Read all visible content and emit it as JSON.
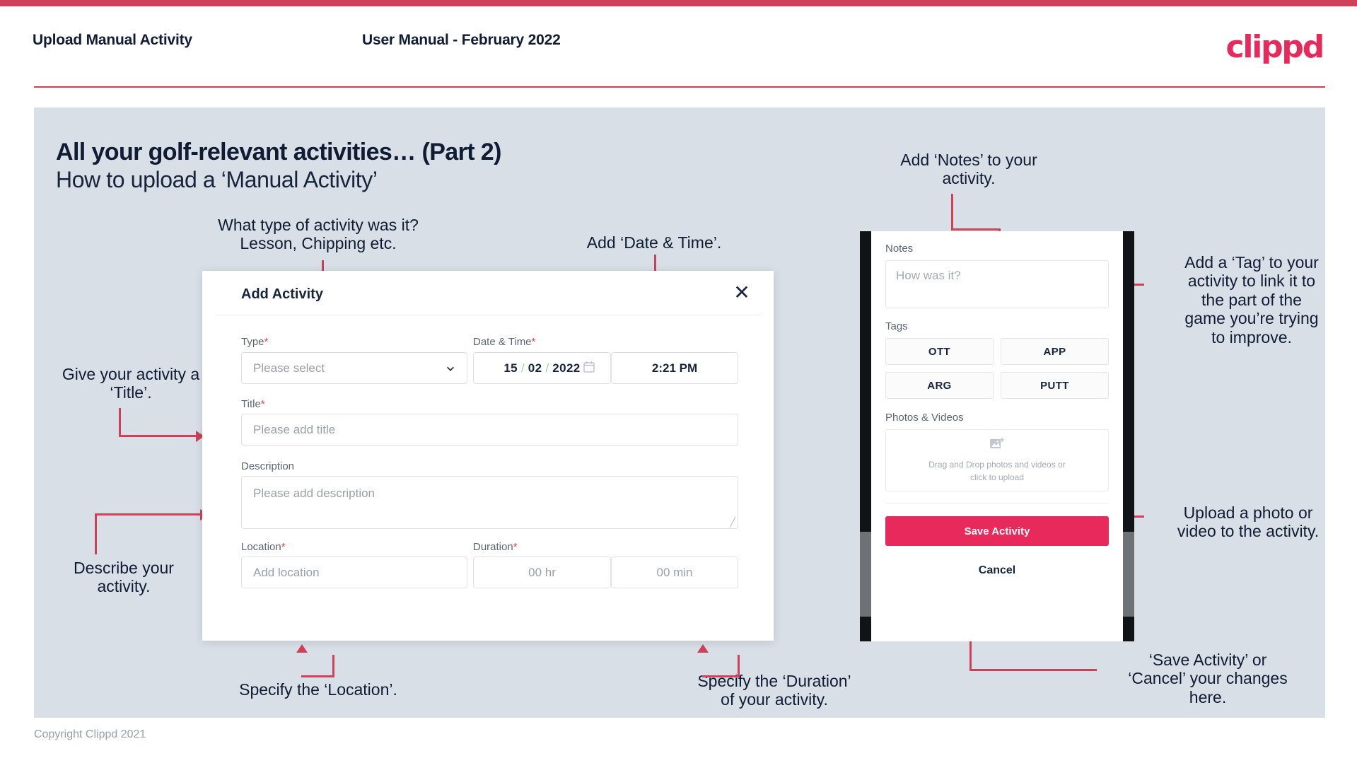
{
  "header": {
    "title": "Upload Manual Activity",
    "subtitle": "User Manual - February 2022",
    "logo": "clippd"
  },
  "slide": {
    "title": "All your golf-relevant activities… (Part 2)",
    "subtitle": "How to upload a ‘Manual Activity’"
  },
  "annotations": {
    "type": "What type of activity was it?\nLesson, Chipping etc.",
    "datetime": "Add ‘Date & Time’.",
    "title_field": "Give your activity a\n‘Title’.",
    "description": "Describe your\nactivity.",
    "location": "Specify the ‘Location’.",
    "duration": "Specify the ‘Duration’\nof your activity.",
    "notes": "Add ‘Notes’ to your\nactivity.",
    "tags": "Add a ‘Tag’ to your\nactivity to link it to\nthe part of the\ngame you’re trying\nto improve.",
    "photos": "Upload a photo or\nvideo to the activity.",
    "save_cancel": "‘Save Activity’ or\n‘Cancel’ your changes\nhere."
  },
  "modal": {
    "title": "Add Activity",
    "close_icon": "close-icon",
    "fields": {
      "type": {
        "label": "Type",
        "required": "*",
        "placeholder": "Please select",
        "chevron_icon": "chevron-down-icon"
      },
      "datetime": {
        "label": "Date & Time",
        "required": "*",
        "day": "15",
        "month": "02",
        "year": "2022",
        "sep": "/",
        "calendar_icon": "calendar-icon",
        "time": "2:21 PM"
      },
      "title": {
        "label": "Title",
        "required": "*",
        "placeholder": "Please add title"
      },
      "description": {
        "label": "Description",
        "required": "",
        "placeholder": "Please add description"
      },
      "location": {
        "label": "Location",
        "required": "*",
        "placeholder": "Add location"
      },
      "duration": {
        "label": "Duration",
        "required": "*",
        "hours_placeholder": "00 hr",
        "minutes_placeholder": "00 min"
      }
    }
  },
  "phone": {
    "notes": {
      "label": "Notes",
      "placeholder": "How was it?"
    },
    "tags": {
      "label": "Tags",
      "items": [
        "OTT",
        "APP",
        "ARG",
        "PUTT"
      ]
    },
    "photos": {
      "label": "Photos & Videos",
      "dropzone_line1": "Drag and Drop photos and videos or",
      "dropzone_line2": "click to upload",
      "icon": "add-image-icon"
    },
    "save_label": "Save Activity",
    "cancel_label": "Cancel"
  },
  "footer": {
    "copyright": "Copyright Clippd 2021"
  },
  "colors": {
    "brand_crimson": "#e8295b",
    "accent_line": "#cf4059",
    "slide_bg": "#d9dfe7",
    "text_dark": "#0f1c33",
    "required_red": "#f4433c"
  }
}
